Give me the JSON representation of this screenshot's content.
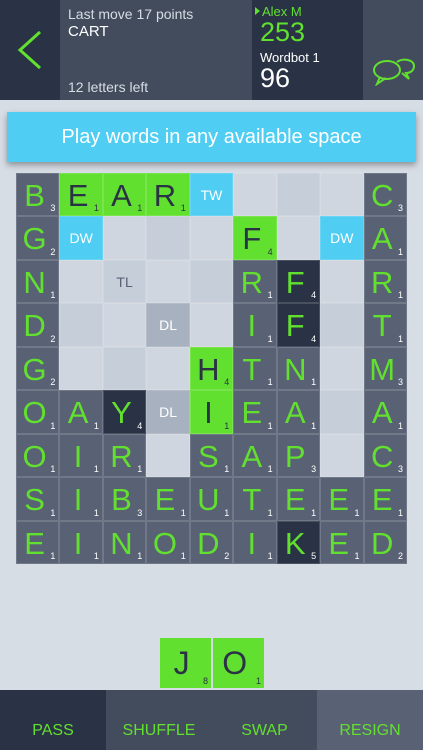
{
  "header": {
    "last_move": "Last move 17 points",
    "last_word": "CART",
    "letters_left": "12 letters left",
    "player1_name": "Alex M",
    "player1_score": "253",
    "player2_name": "Wordbot 1",
    "player2_score": "96"
  },
  "banner": {
    "text": "Play words in any available space"
  },
  "board": {
    "rows": 9,
    "cols": 9,
    "cells": [
      [
        {
          "l": "B",
          "p": "3"
        },
        {
          "l": "E",
          "p": "1",
          "g": 1
        },
        {
          "l": "A",
          "p": "1",
          "g": 1
        },
        {
          "l": "R",
          "p": "1",
          "g": 1
        },
        {
          "prem": "TW"
        },
        {},
        {},
        {},
        {
          "l": "C",
          "p": "3"
        }
      ],
      [
        {
          "l": "G",
          "p": "2"
        },
        {
          "prem": "DW"
        },
        {},
        {},
        {},
        {
          "l": "F",
          "p": "4",
          "g": 1
        },
        {},
        {
          "prem": "DW"
        },
        {
          "l": "A",
          "p": "1"
        }
      ],
      [
        {
          "l": "N",
          "p": "1"
        },
        {},
        {
          "prem": "TL"
        },
        {},
        {},
        {
          "l": "R",
          "p": "1"
        },
        {
          "l": "F",
          "p": "4",
          "d": 1
        },
        {},
        {
          "l": "R",
          "p": "1"
        }
      ],
      [
        {
          "l": "D",
          "p": "2"
        },
        {},
        {},
        {
          "prem": "DL"
        },
        {},
        {
          "l": "I",
          "p": "1"
        },
        {
          "l": "F",
          "p": "4",
          "d": 1
        },
        {},
        {
          "l": "T",
          "p": "1"
        }
      ],
      [
        {
          "l": "G",
          "p": "2"
        },
        {},
        {},
        {},
        {
          "l": "H",
          "p": "4",
          "g": 1
        },
        {
          "l": "T",
          "p": "1"
        },
        {
          "l": "N",
          "p": "1"
        },
        {},
        {
          "l": "M",
          "p": "3"
        }
      ],
      [
        {
          "l": "O",
          "p": "1"
        },
        {
          "l": "A",
          "p": "1"
        },
        {
          "l": "Y",
          "p": "4",
          "d": 1
        },
        {
          "prem": "DL"
        },
        {
          "l": "I",
          "p": "1",
          "g": 1
        },
        {
          "l": "E",
          "p": "1"
        },
        {
          "l": "A",
          "p": "1"
        },
        {},
        {
          "l": "A",
          "p": "1"
        }
      ],
      [
        {
          "l": "O",
          "p": "1"
        },
        {
          "l": "I",
          "p": "1"
        },
        {
          "l": "R",
          "p": "1"
        },
        {},
        {
          "l": "S",
          "p": "1"
        },
        {
          "l": "A",
          "p": "1"
        },
        {
          "l": "P",
          "p": "3"
        },
        {},
        {
          "l": "C",
          "p": "3"
        }
      ],
      [
        {
          "l": "S",
          "p": "1"
        },
        {
          "l": "I",
          "p": "1"
        },
        {
          "l": "B",
          "p": "3"
        },
        {
          "l": "E",
          "p": "1"
        },
        {
          "l": "U",
          "p": "1"
        },
        {
          "l": "T",
          "p": "1"
        },
        {
          "l": "E",
          "p": "1"
        },
        {
          "l": "E",
          "p": "1"
        },
        {
          "l": "E",
          "p": "1"
        }
      ],
      [
        {
          "l": "E",
          "p": "1"
        },
        {
          "l": "I",
          "p": "1"
        },
        {
          "l": "N",
          "p": "1"
        },
        {
          "l": "O",
          "p": "1"
        },
        {
          "l": "D",
          "p": "2"
        },
        {
          "l": "I",
          "p": "1"
        },
        {
          "l": "K",
          "p": "5",
          "d": 1
        },
        {
          "l": "E",
          "p": "1"
        },
        {
          "l": "D",
          "p": "2"
        }
      ]
    ]
  },
  "rack": [
    {
      "letter": "J",
      "points": "8"
    },
    {
      "letter": "O",
      "points": "1"
    }
  ],
  "footer": {
    "pass": "PASS",
    "shuffle": "SHUFFLE",
    "swap": "SWAP",
    "resign": "RESIGN"
  },
  "colors": {
    "accent_green": "#62e02f",
    "highlight_blue": "#4fcdf2",
    "dark_navy": "#2a3346",
    "slate": "#434c5c",
    "tile_slate": "#596274"
  }
}
